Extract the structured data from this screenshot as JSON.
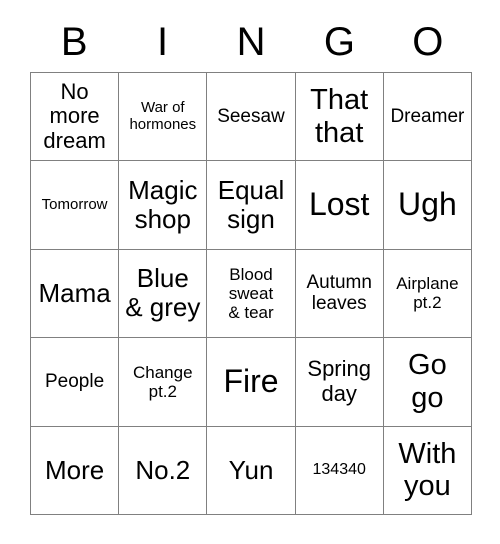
{
  "card": {
    "title": "BINGO",
    "columns": [
      "B",
      "I",
      "N",
      "G",
      "O"
    ],
    "grid_color": "#808080",
    "text_color": "#000000",
    "background_color": "#ffffff",
    "rows": 5,
    "cols": 5,
    "cells": [
      [
        {
          "label": "No\nmore\ndream",
          "size": "fs-md"
        },
        {
          "label": "War of\nhormones",
          "size": "fs-xxs"
        },
        {
          "label": "Seesaw",
          "size": "fs-sm"
        },
        {
          "label": "That\nthat",
          "size": "fs-xl"
        },
        {
          "label": "Dreamer",
          "size": "fs-sm"
        }
      ],
      [
        {
          "label": "Tomorrow",
          "size": "fs-xxs"
        },
        {
          "label": "Magic\nshop",
          "size": "fs-lg"
        },
        {
          "label": "Equal\nsign",
          "size": "fs-lg"
        },
        {
          "label": "Lost",
          "size": "fs-xxl"
        },
        {
          "label": "Ugh",
          "size": "fs-xxl"
        }
      ],
      [
        {
          "label": "Mama",
          "size": "fs-lg"
        },
        {
          "label": "Blue\n& grey",
          "size": "fs-lg"
        },
        {
          "label": "Blood\nsweat\n& tear",
          "size": "fs-xs"
        },
        {
          "label": "Autumn\nleaves",
          "size": "fs-sm"
        },
        {
          "label": "Airplane\npt.2",
          "size": "fs-xs"
        }
      ],
      [
        {
          "label": "People",
          "size": "fs-sm"
        },
        {
          "label": "Change\npt.2",
          "size": "fs-xs"
        },
        {
          "label": "Fire",
          "size": "fs-xxl"
        },
        {
          "label": "Spring\nday",
          "size": "fs-md"
        },
        {
          "label": "Go\ngo",
          "size": "fs-xl"
        }
      ],
      [
        {
          "label": "More",
          "size": "fs-lg"
        },
        {
          "label": "No.2",
          "size": "fs-lg"
        },
        {
          "label": "Yun",
          "size": "fs-lg"
        },
        {
          "label": "134340",
          "size": "fs-num"
        },
        {
          "label": "With\nyou",
          "size": "fs-xl"
        }
      ]
    ]
  }
}
